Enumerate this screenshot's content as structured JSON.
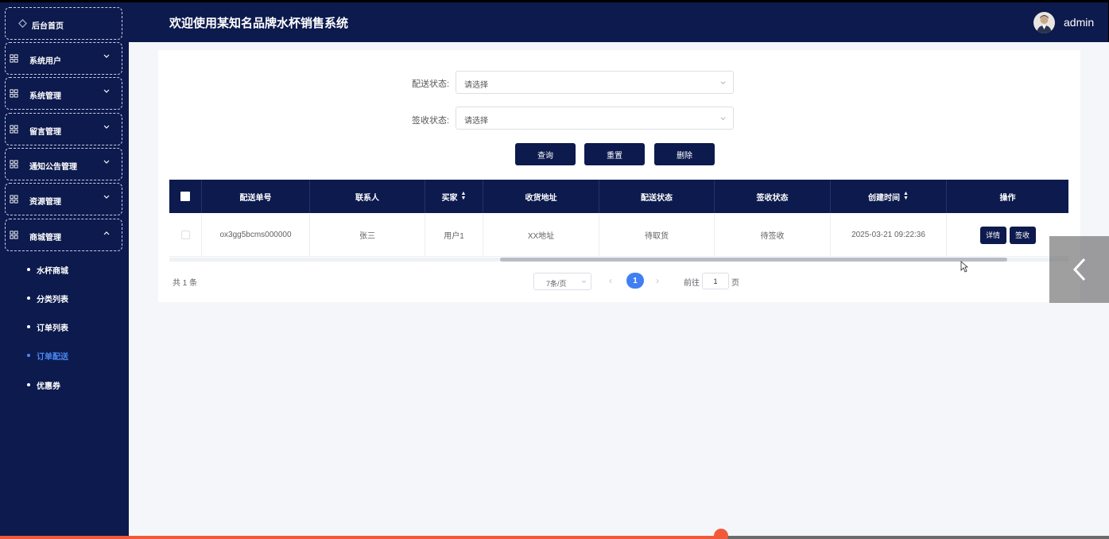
{
  "header": {
    "title": "欢迎使用某知名品牌水杯销售系统",
    "user": "admin"
  },
  "sidebar": {
    "home": "后台首页",
    "menus": [
      {
        "label": "系统用户",
        "icon": "grid-icon"
      },
      {
        "label": "系统管理",
        "icon": "grid-icon"
      },
      {
        "label": "留言管理",
        "icon": "grid-icon"
      },
      {
        "label": "通知公告管理",
        "icon": "grid-icon"
      },
      {
        "label": "资源管理",
        "icon": "grid-icon"
      },
      {
        "label": "商城管理",
        "icon": "grid-icon",
        "expanded": true
      }
    ],
    "sub_items": [
      {
        "label": "水杯商城"
      },
      {
        "label": "分类列表"
      },
      {
        "label": "订单列表"
      },
      {
        "label": "订单配送",
        "active": true
      },
      {
        "label": "优惠券"
      }
    ]
  },
  "filters": {
    "delivery_label": "配送状态:",
    "delivery_placeholder": "请选择",
    "sign_label": "签收状态:",
    "sign_placeholder": "请选择"
  },
  "buttons": {
    "query": "查询",
    "reset": "重置",
    "delete": "删除"
  },
  "table": {
    "columns": [
      "配送单号",
      "联系人",
      "买家",
      "收货地址",
      "配送状态",
      "签收状态",
      "创建时间",
      "操作"
    ],
    "rows": [
      {
        "order_no": "ox3gg5bcms000000",
        "contact": "张三",
        "buyer": "用户1",
        "address": "XX地址",
        "delivery_status": "待取货",
        "sign_status": "待签收",
        "created": "2025-03-21 09:22:36",
        "actions": [
          "详情",
          "签收"
        ]
      }
    ]
  },
  "pagination": {
    "total": "共 1 条",
    "page_size": "7条/页",
    "current_page": "1",
    "goto_prefix": "前往",
    "goto_value": "1",
    "goto_suffix": "页"
  },
  "colors": {
    "navy": "#0c1a4d",
    "accent": "#3f7ff2",
    "progress": "#f05a3a"
  },
  "video_progress": 0.65
}
